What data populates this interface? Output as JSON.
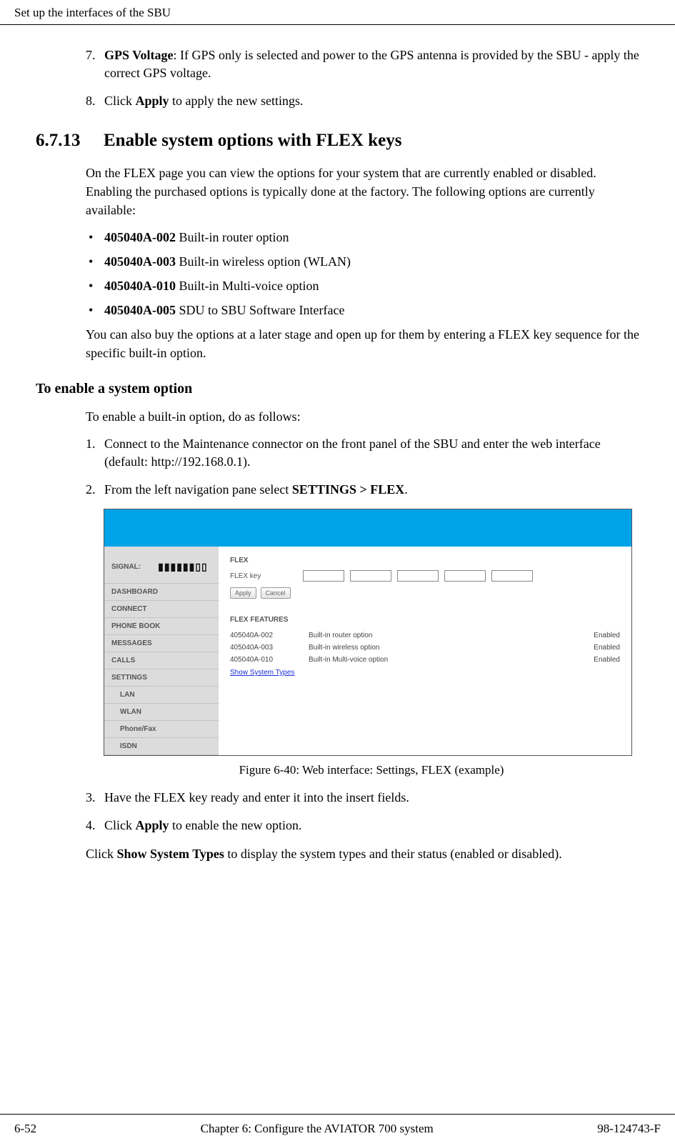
{
  "header": {
    "title": "Set up the interfaces of the SBU"
  },
  "steps_top": [
    {
      "num": "7.",
      "bold": "GPS Voltage",
      "rest": ": If GPS only is selected and power to the GPS antenna is provided by the SBU - apply the correct GPS voltage."
    },
    {
      "num": "8.",
      "pre": "Click ",
      "bold": "Apply",
      "rest": " to apply the new settings."
    }
  ],
  "section": {
    "num": "6.7.13",
    "title": "Enable system options with FLEX keys"
  },
  "intro": "On the FLEX page you can view the options for your system that are currently enabled or disabled. Enabling the purchased options is typically done at the factory. The following options are currently available:",
  "options": [
    {
      "code": "405040A-002",
      "desc": " Built-in router option"
    },
    {
      "code": "405040A-003",
      "desc": " Built-in wireless option (WLAN)"
    },
    {
      "code": "405040A-010",
      "desc": " Built-in Multi-voice option"
    },
    {
      "code": "405040A-005",
      "desc": " SDU to SBU Software Interface"
    }
  ],
  "after_options": "You can also buy the options at a later stage and open up for them by entering a FLEX key sequence for the specific built-in option.",
  "enable_heading": "To enable a system option",
  "enable_intro": "To enable a built-in option, do as follows:",
  "enable_steps": {
    "s1": {
      "num": "1.",
      "text_a": "Connect to the Maintenance connector on the front panel of the SBU and enter the web interface (default: http://192.168.0.1)."
    },
    "s2": {
      "num": "2.",
      "pre": "From the left navigation pane select ",
      "bold": "SETTINGS > FLEX",
      "post": "."
    },
    "s3": {
      "num": "3.",
      "text": "Have the FLEX key ready and enter it into the insert fields."
    },
    "s4": {
      "num": "4.",
      "pre": "Click ",
      "bold": "Apply",
      "post": " to enable the new option."
    }
  },
  "figure_caption": "Figure 6-40: Web interface: Settings, FLEX (example)",
  "final_para": {
    "pre": "Click ",
    "bold": "Show System Types",
    "post": " to display the system types and their status (enabled or disabled)."
  },
  "footer": {
    "left": "6-52",
    "center": "Chapter 6:  Configure the AVIATOR 700 system",
    "right": "98-124743-F"
  },
  "ui": {
    "signal_label": "SIGNAL:",
    "nav": [
      "DASHBOARD",
      "CONNECT",
      "PHONE BOOK",
      "MESSAGES",
      "CALLS",
      "SETTINGS"
    ],
    "nav_sub": [
      "LAN",
      "WLAN",
      "Phone/Fax",
      "ISDN"
    ],
    "flex_title": "FLEX",
    "flex_key_label": "FLEX key",
    "apply_btn": "Apply",
    "cancel_btn": "Cancel",
    "features_title": "FLEX FEATURES",
    "features": [
      {
        "code": "405040A-002",
        "desc": "Built-in router option",
        "status": "Enabled"
      },
      {
        "code": "405040A-003",
        "desc": "Built-in wireless option",
        "status": "Enabled"
      },
      {
        "code": "405040A-010",
        "desc": "Built-in Multi-voice option",
        "status": "Enabled"
      }
    ],
    "show_link": "Show System Types"
  }
}
